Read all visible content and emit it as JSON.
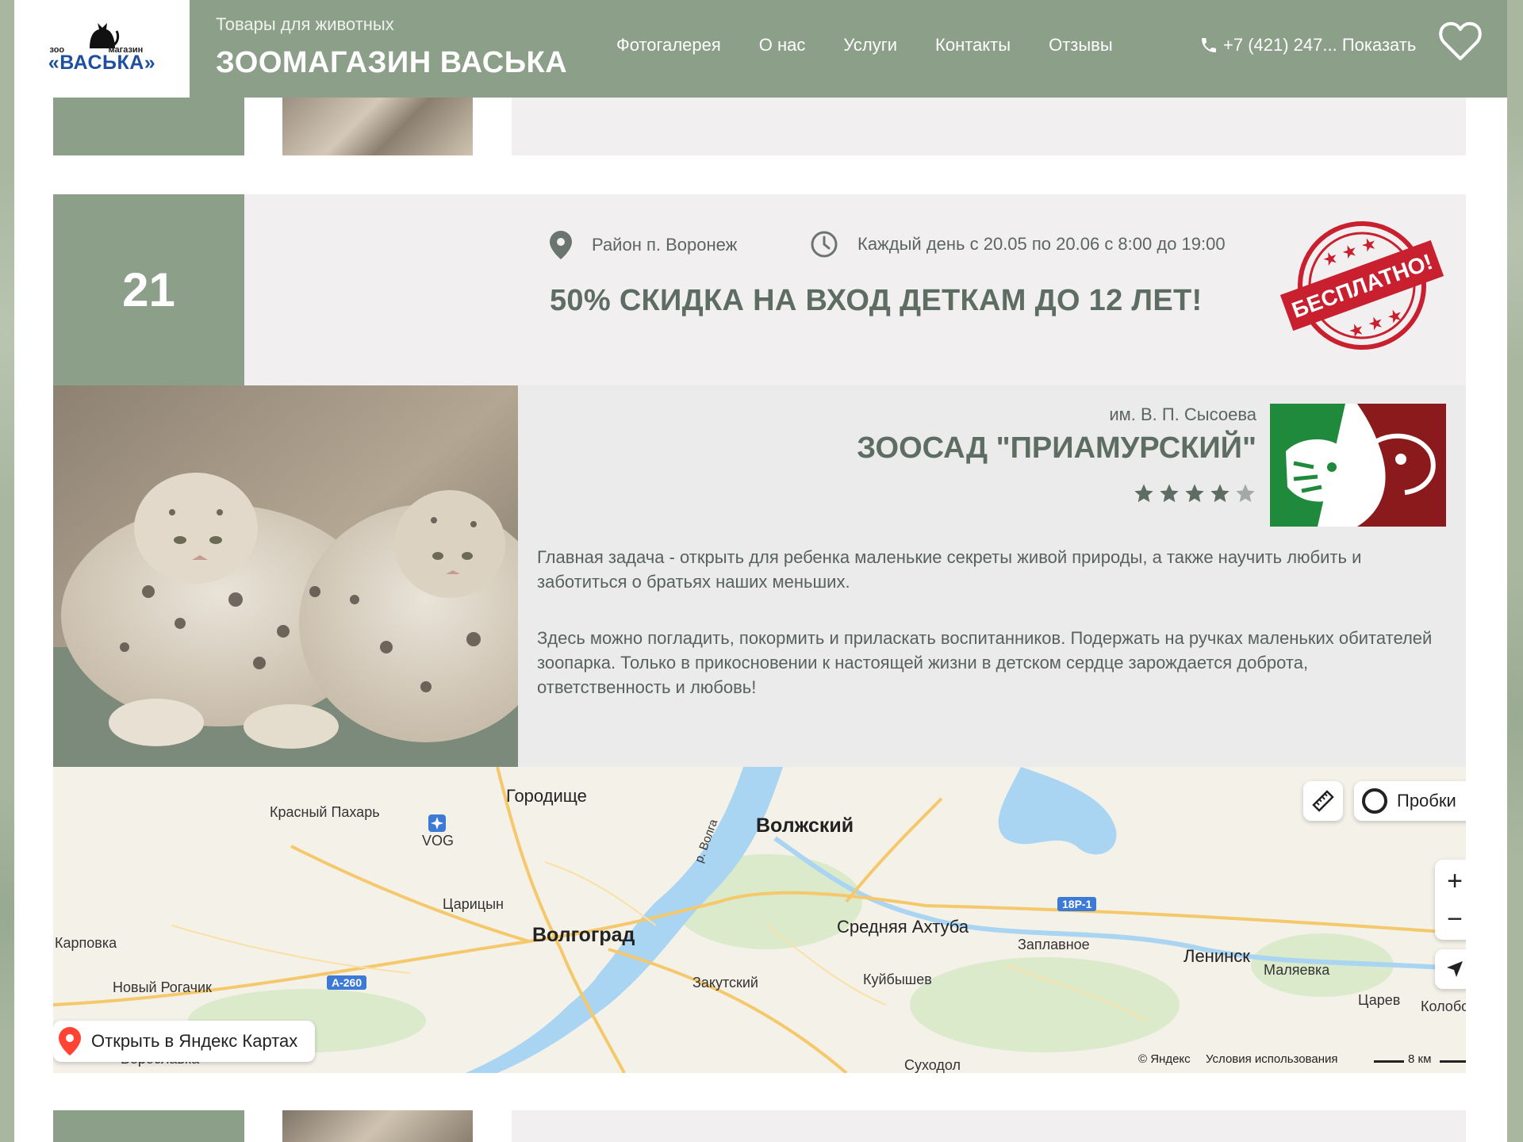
{
  "header": {
    "logo": {
      "top_left": "зоо",
      "top_right": "магазин",
      "main": "«ВАСЬКА»"
    },
    "subtitle": "Товары для животных",
    "title": "ЗООМАГАЗИН ВАСЬКА",
    "nav": [
      "Фотогалерея",
      "О нас",
      "Услуги",
      "Контакты",
      "Отзывы"
    ],
    "phone": "+7 (421) 247... Показать",
    "icons": {
      "phone": "phone-icon",
      "favorite": "heart-icon"
    }
  },
  "event": {
    "day": "21",
    "location": "Район п. Воронеж",
    "schedule": "Каждый день с 20.05 по 20.06 с 8:00 до 19:00",
    "promo": "50% СКИДКА НА ВХОД ДЕТКАМ ДО 12 ЛЕТ!",
    "stamp_text": "БЕСПЛАТНО!",
    "org_subtitle": "им. В. П. Сысоева",
    "org_title": "ЗООСАД \"ПРИАМУРСКИЙ\"",
    "rating": {
      "value": 4,
      "max": 5
    },
    "description": [
      "Главная задача - открыть для ребенка маленькие секреты живой природы, а также научить любить и заботиться о братьях наших меньших.",
      "Здесь можно погладить, покормить и приласкать воспитанников. Подержать на ручках маленьких обитателей зоопарка. Только в прикосновении к настоящей жизни в детском сердце зарождается доброта, ответственность и любовь!"
    ]
  },
  "map": {
    "labels": {
      "gorodishche": "Городище",
      "krasny": "Красный Пахарь",
      "vog": "VOG",
      "volzhsky": "Волжский",
      "volga": "р. Волга",
      "tsaritsyn": "Царицын",
      "karpovka": "Карповка",
      "volgograd": "Волгоград",
      "sredn": "Средняя Ахтуба",
      "zaplav": "Заплавное",
      "leninsk": "Ленинск",
      "malyaevka": "Маляевка",
      "rogachik": "Новый Рогачик",
      "zakut": "Закутский",
      "kuib": "Куйбышев",
      "tsarev": "Царев",
      "kolob": "Колобо",
      "sukhodol": "Суходол",
      "bereslavka": "Береславка",
      "road1": "18Р-1",
      "road2": "А-260"
    },
    "traffic_button": "Пробки",
    "open_button": "Открыть в Яндекс Картах",
    "copyright": "© Яндекс",
    "terms": "Условия использования",
    "scale": "8 км",
    "zoom_in": "+",
    "zoom_out": "−"
  },
  "colors": {
    "header_green": "#8c9f89",
    "card_gray": "#f1eff0",
    "stamp_red": "#c8202f",
    "text_title": "#5d6d63"
  }
}
